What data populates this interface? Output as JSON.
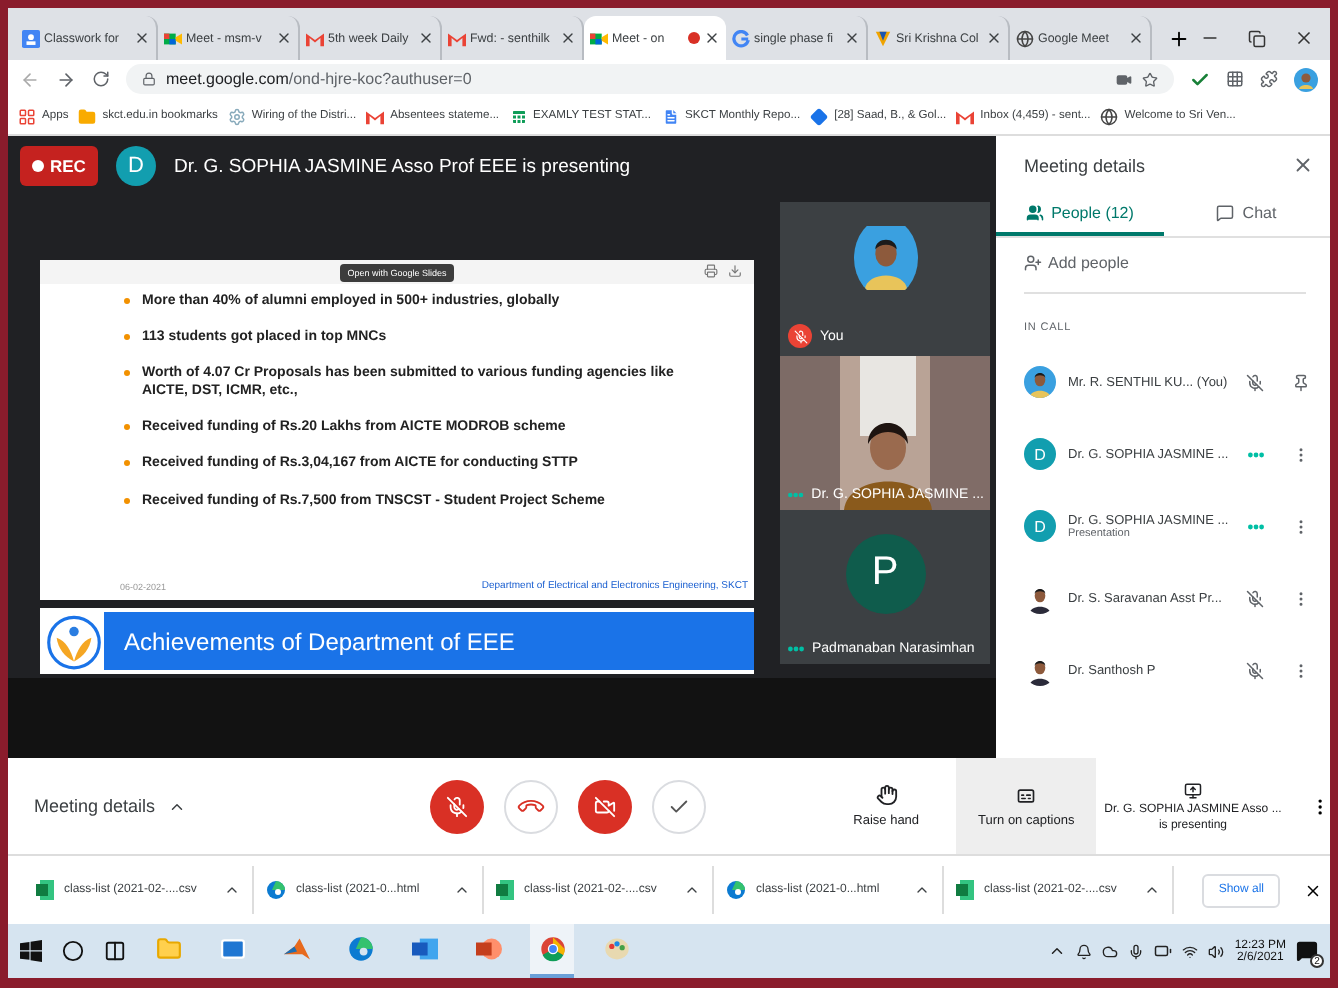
{
  "browser": {
    "tabs": [
      {
        "title": "Classwork for",
        "kind": "classroom",
        "selected": false,
        "recording": false
      },
      {
        "title": "Meet - msm-v",
        "kind": "meet",
        "selected": false,
        "recording": false
      },
      {
        "title": "5th week Daily",
        "kind": "gmail",
        "selected": false,
        "recording": false
      },
      {
        "title": "Fwd: - senthilk",
        "kind": "gmail",
        "selected": false,
        "recording": false
      },
      {
        "title": "Meet - on",
        "kind": "meet",
        "selected": true,
        "recording": true
      },
      {
        "title": "single phase fi",
        "kind": "google",
        "selected": false,
        "recording": false
      },
      {
        "title": "Sri Krishna Col",
        "kind": "shield",
        "selected": false,
        "recording": false
      },
      {
        "title": "Google Meet",
        "kind": "globe",
        "selected": false,
        "recording": false
      }
    ],
    "url_host": "meet.google.com",
    "url_path": "/ond-hjre-koc?authuser=0",
    "bookmarks": [
      {
        "label": "Apps",
        "kind": "apps"
      },
      {
        "label": "skct.edu.in bookmarks",
        "kind": "folder"
      },
      {
        "label": "Wiring of the Distri...",
        "kind": "gear"
      },
      {
        "label": "Absentees stateme...",
        "kind": "gmail"
      },
      {
        "label": "EXAMLY TEST STAT...",
        "kind": "sheet"
      },
      {
        "label": "SKCT Monthly Repo...",
        "kind": "doc"
      },
      {
        "label": "[28] Saad, B., & Gol...",
        "kind": "diamond"
      },
      {
        "label": "Inbox (4,459) - sent...",
        "kind": "gmail"
      },
      {
        "label": "Welcome to Sri Ven...",
        "kind": "globe"
      }
    ]
  },
  "meet": {
    "rec": "REC",
    "presenter_initial": "D",
    "presenting": "Dr. G. SOPHIA JASMINE Asso Prof EEE is presenting",
    "slide": {
      "viewer_button": "Open with Google Slides",
      "bullets": [
        "More than 40% of alumni employed in 500+ industries, globally",
        "113 students got placed in top MNCs",
        "Worth of 4.07 Cr Proposals has been submitted to various funding agencies like AICTE, DST, ICMR, etc.,",
        "Received funding of Rs.20 Lakhs from AICTE MODROB scheme",
        "Received funding of Rs.3,04,167 from AICTE for conducting STTP",
        "Received  funding of Rs.7,500 from TNSCST - Student Project Scheme"
      ],
      "date": "06-02-2021",
      "department": "Department of Electrical and Electronics Engineering, SKCT"
    },
    "next_slide_title": "Achievements of Department of EEE",
    "tiles": [
      {
        "kind": "self",
        "name": "You",
        "muted": true
      },
      {
        "kind": "video",
        "name": "Dr. G. SOPHIA JASMINE ...",
        "muted": false
      },
      {
        "kind": "initial",
        "initial": "P",
        "name": "Padmanaban Narasimhan",
        "muted": false
      }
    ]
  },
  "sidebar": {
    "title": "Meeting details",
    "tabs": [
      {
        "label": "People (12)",
        "kind": "people",
        "selected": true
      },
      {
        "label": "Chat",
        "kind": "chat",
        "selected": false
      }
    ],
    "add_people": "Add people",
    "section": "IN CALL",
    "people": [
      {
        "name": "Mr. R. SENTHIL KU...",
        "suffix": "(You)",
        "kind": "self",
        "muted": true
      },
      {
        "name": "Dr. G. SOPHIA JASMINE ...",
        "kind": "other",
        "avatar": {
          "kind": "initial",
          "letter": "D"
        },
        "muted": false
      },
      {
        "name": "Dr. G. SOPHIA JASMINE ...",
        "subtitle": "Presentation",
        "kind": "other",
        "avatar": {
          "kind": "initial",
          "letter": "D"
        },
        "muted": false
      },
      {
        "name": "Dr. S. Saravanan Asst Pr...",
        "kind": "other",
        "muted": true
      },
      {
        "name": "Dr. Santhosh P",
        "kind": "other",
        "muted": true
      }
    ]
  },
  "controls_bar": {
    "details": "Meeting details",
    "controls": [
      {
        "kind": "mic",
        "on": false
      },
      {
        "kind": "hangup",
        "on": true
      },
      {
        "kind": "camera",
        "on": false
      },
      {
        "kind": "check",
        "on": true
      }
    ],
    "actions": [
      {
        "kind": "hand",
        "label": "Raise hand",
        "highlighted": false
      },
      {
        "kind": "captions",
        "label": "Turn on captions",
        "highlighted": true
      }
    ],
    "presenting": {
      "name": "Dr. G. SOPHIA JASMINE Asso ...",
      "status": "is presenting"
    }
  },
  "downloads": {
    "items": [
      {
        "name": "class-list (2021-02-....csv",
        "kind": "csv"
      },
      {
        "name": "class-list (2021-0...html",
        "kind": "html"
      },
      {
        "name": "class-list (2021-02-....csv",
        "kind": "csv"
      },
      {
        "name": "class-list (2021-0...html",
        "kind": "html"
      },
      {
        "name": "class-list (2021-02-....csv",
        "kind": "csv"
      }
    ],
    "show_all": "Show all"
  },
  "taskbar": {
    "apps": [
      {
        "kind": "explorer",
        "active": false
      },
      {
        "kind": "mail",
        "active": false
      },
      {
        "kind": "matlab",
        "active": false
      },
      {
        "kind": "edge",
        "active": false
      },
      {
        "kind": "word",
        "active": false
      },
      {
        "kind": "powerpoint",
        "active": false
      },
      {
        "kind": "chrome",
        "active": true
      },
      {
        "kind": "paint",
        "active": false
      }
    ],
    "time": "12:23 PM",
    "date": "2/6/2021",
    "notifications": "2"
  }
}
